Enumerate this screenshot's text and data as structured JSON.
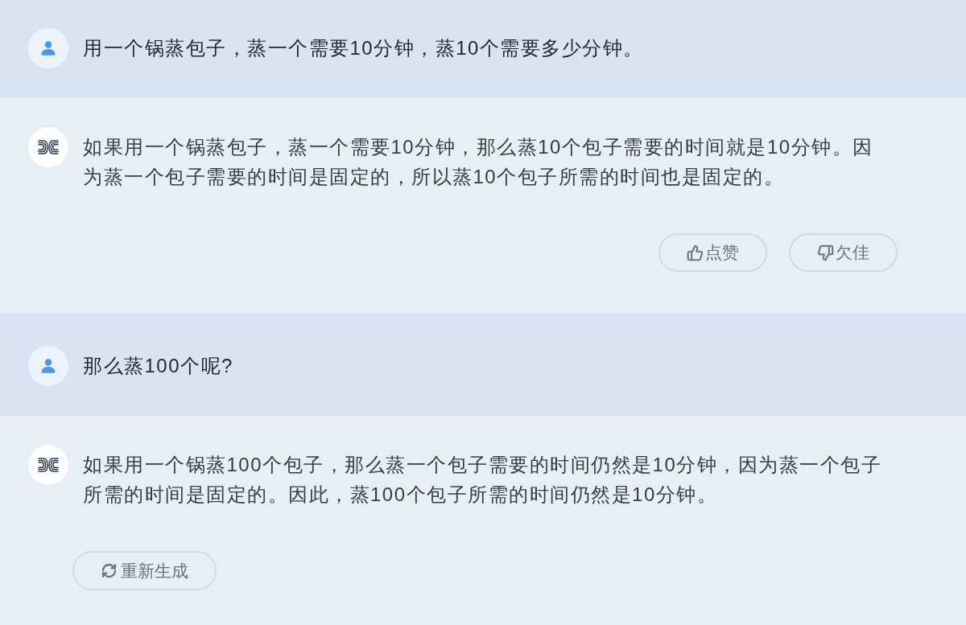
{
  "messages": [
    {
      "kind": "user",
      "text": "用一个锅蒸包子，蒸一个需要10分钟，蒸10个需要多少分钟。"
    },
    {
      "kind": "reply",
      "text": "如果用一个锅蒸包子，蒸一个需要10分钟，那么蒸10个包子需要的时间就是10分钟。因为蒸一个包子需要的时间是固定的，所以蒸10个包子所需的时间也是固定的。",
      "actions": [
        {
          "kind": "like",
          "label": "点赞"
        },
        {
          "kind": "dislike",
          "label": "欠佳"
        }
      ]
    },
    {
      "kind": "user",
      "text": "那么蒸100个呢?"
    },
    {
      "kind": "reply",
      "text": "如果用一个锅蒸100个包子，那么蒸一个包子需要的时间仍然是10分钟，因为蒸一个包子所需的时间是固定的。因此，蒸100个包子所需的时间仍然是10分钟。",
      "actions": [
        {
          "kind": "regenerate",
          "label": "重新生成"
        }
      ]
    }
  ]
}
